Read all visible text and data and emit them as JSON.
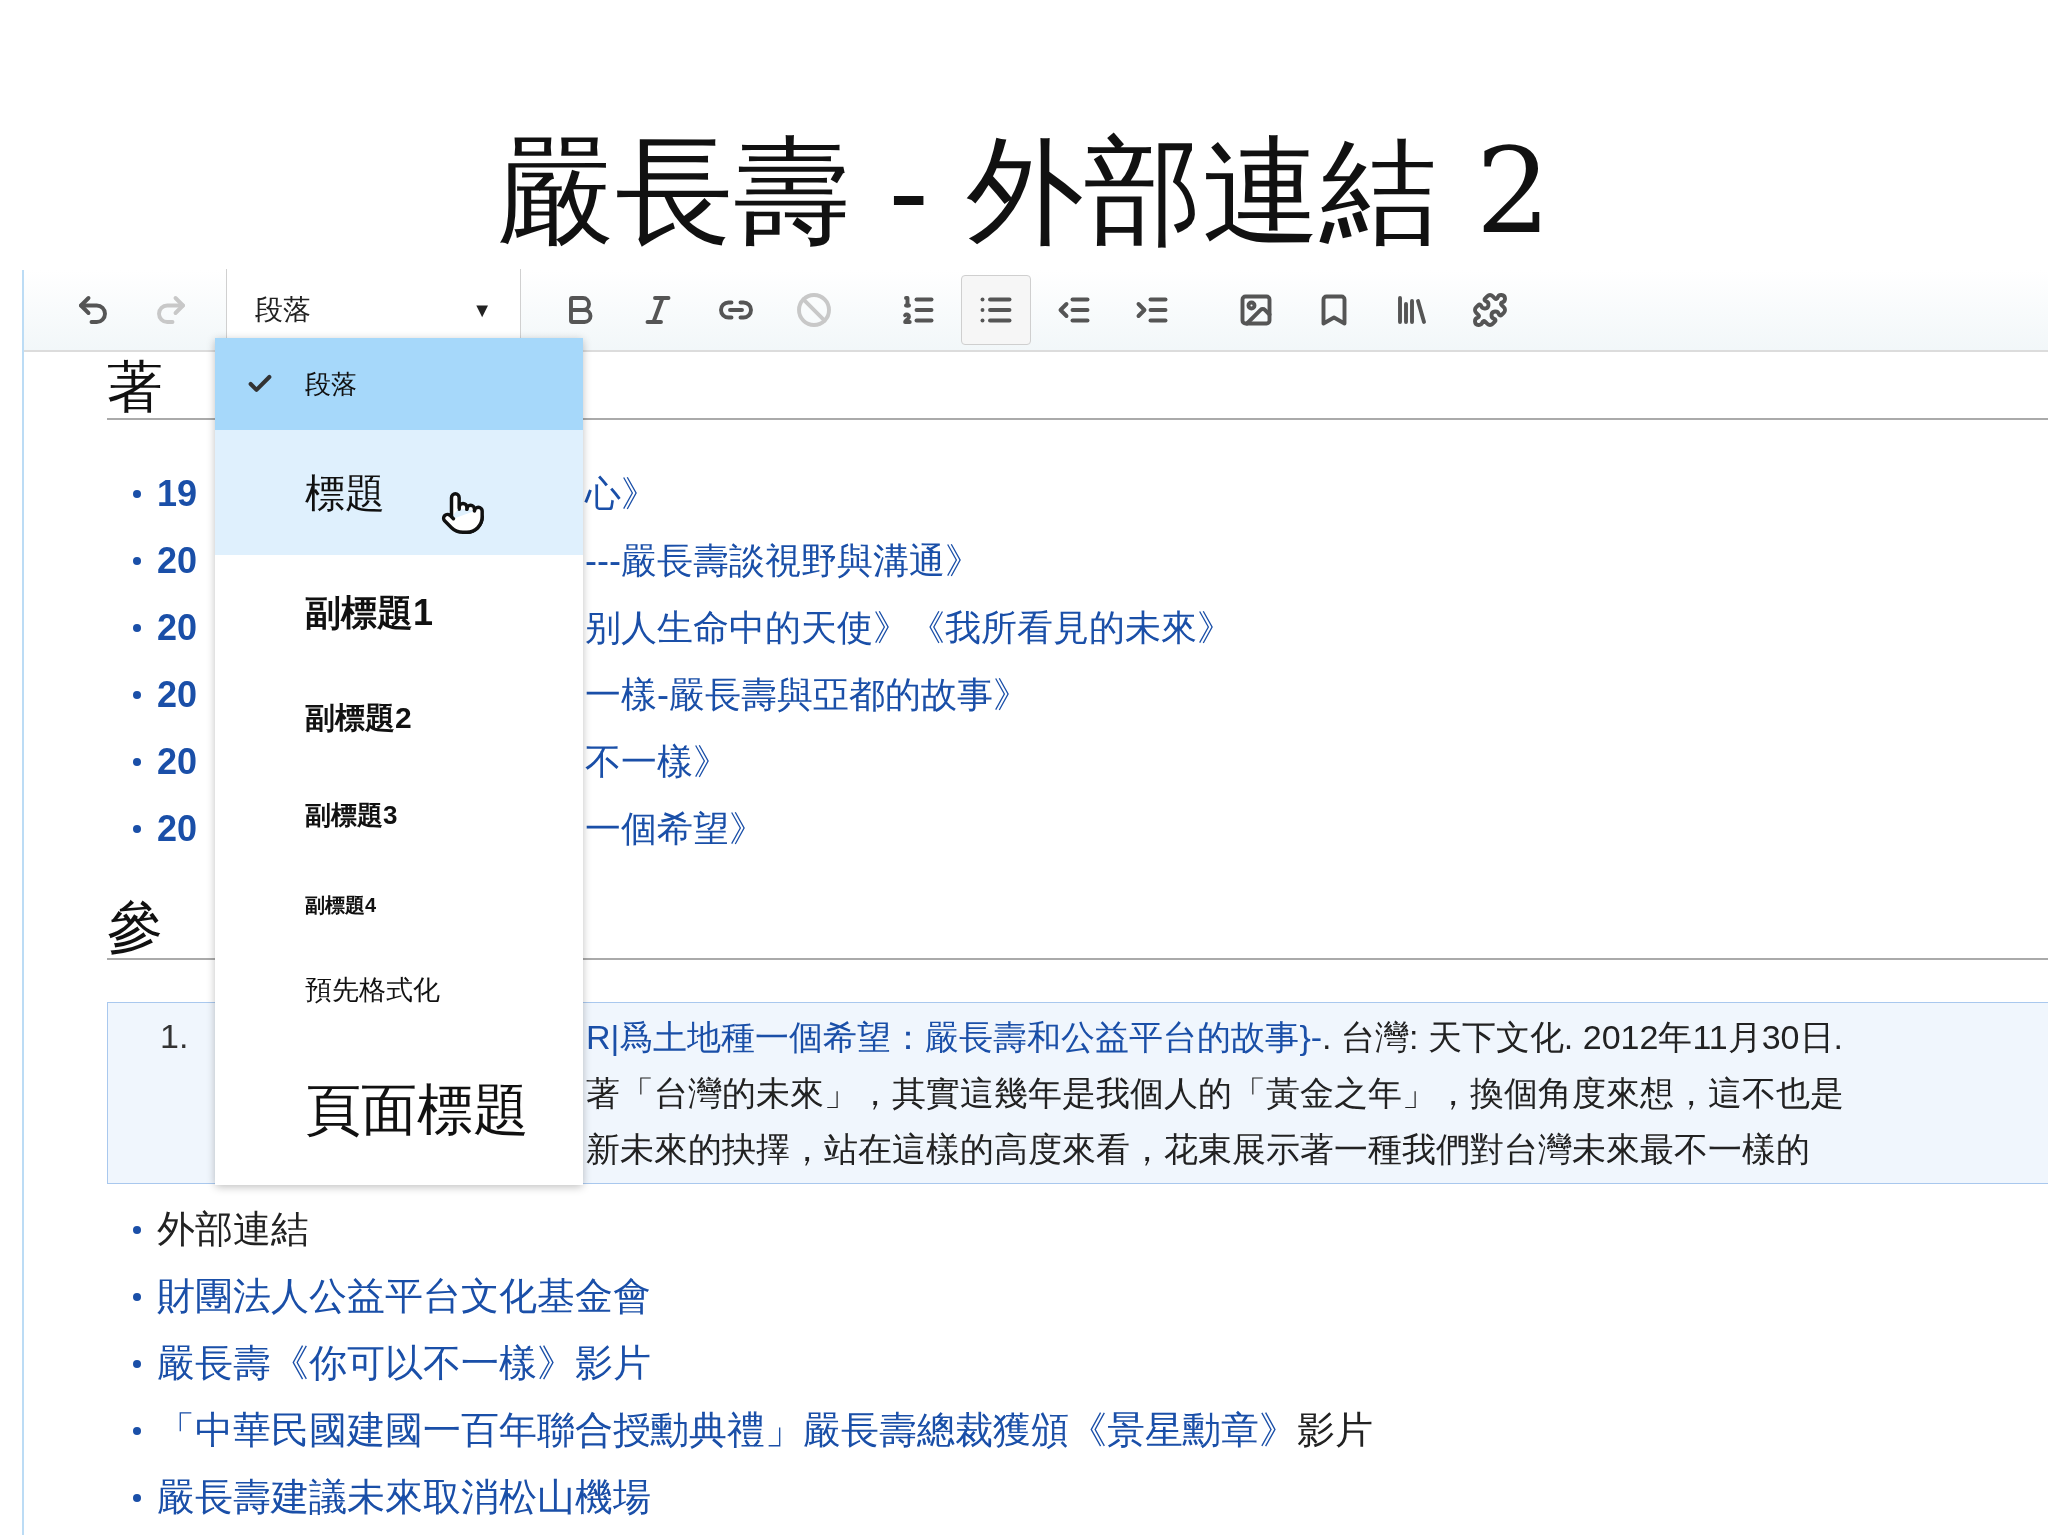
{
  "slide_title": "嚴長壽 - 外部連結 2",
  "toolbar": {
    "buttons": [
      {
        "kind": "undo",
        "disabled": false,
        "active": false
      },
      {
        "kind": "redo",
        "disabled": true,
        "active": false
      },
      {
        "kind": "format",
        "disabled": false,
        "active": false
      },
      {
        "kind": "bold",
        "disabled": false,
        "active": false
      },
      {
        "kind": "italic",
        "disabled": false,
        "active": false
      },
      {
        "kind": "link",
        "disabled": false,
        "active": false
      },
      {
        "kind": "clear",
        "disabled": true,
        "active": false
      },
      {
        "kind": "numbered_list",
        "disabled": false,
        "active": false
      },
      {
        "kind": "bullet_list",
        "disabled": false,
        "active": true
      },
      {
        "kind": "outdent",
        "disabled": false,
        "active": false
      },
      {
        "kind": "indent",
        "disabled": false,
        "active": false
      },
      {
        "kind": "image",
        "disabled": false,
        "active": false
      },
      {
        "kind": "bookmark",
        "disabled": false,
        "active": false
      },
      {
        "kind": "books",
        "disabled": false,
        "active": false
      },
      {
        "kind": "puzzle",
        "disabled": false,
        "active": false
      }
    ],
    "format_dropdown": {
      "value": "段落",
      "caret": "▼"
    }
  },
  "format_menu": {
    "items": [
      {
        "label": "段落",
        "kind": "paragraph",
        "selected": true,
        "hovered": false
      },
      {
        "label": "標題",
        "kind": "heading",
        "selected": false,
        "hovered": true
      },
      {
        "label": "副標題1",
        "kind": "sub1",
        "selected": false,
        "hovered": false
      },
      {
        "label": "副標題2",
        "kind": "sub2",
        "selected": false,
        "hovered": false
      },
      {
        "label": "副標題3",
        "kind": "sub3",
        "selected": false,
        "hovered": false
      },
      {
        "label": "副標題4",
        "kind": "sub4",
        "selected": false,
        "hovered": false
      },
      {
        "label": "預先格式化",
        "kind": "pre",
        "selected": false,
        "hovered": false
      },
      {
        "label": "頁面標題",
        "kind": "page_title",
        "selected": false,
        "hovered": false
      }
    ]
  },
  "heading_1": "著",
  "works_list": [
    {
      "text_start": "19",
      "text_end": "心》"
    },
    {
      "text_start": "20",
      "text_end": "---嚴長壽談視野與溝通》"
    },
    {
      "text_start": "20",
      "text_end": "别人生命中的天使》《我所看見的未來》"
    },
    {
      "text_start": "20",
      "text_end": "一樣-嚴長壽與亞都的故事》"
    },
    {
      "text_start": "20",
      "text_end": "不一樣》"
    },
    {
      "text_start": "20",
      "text_end": "一個希望》"
    }
  ],
  "heading_2": "參",
  "references": [
    {
      "number": "1.",
      "lines": [
        [
          {
            "text": "R|爲土地種一個希望：嚴長壽和公益平台的故事}-",
            "link": true
          },
          {
            "text": ". 台灣: 天下文化. 2012年11月30日.",
            "link": false
          }
        ],
        [
          {
            "text": "著「台灣的未來」，其實這幾年是我個人的「黃金之年」，換個角度來想，這不也是",
            "link": false
          }
        ],
        [
          {
            "text": "新未來的抉擇，站在這樣的高度來看，花東展示著一種我們對台灣未來最不一樣的",
            "link": false
          }
        ]
      ]
    }
  ],
  "external_links": [
    [
      {
        "text": "外部連結",
        "link": false
      }
    ],
    [
      {
        "text": "財團法人公益平台文化基金會",
        "link": true
      }
    ],
    [
      {
        "text": "嚴長壽《你可以不一樣》影片",
        "link": true
      }
    ],
    [
      {
        "text": "「中華民國建國一百年聯合授勳典禮」嚴長壽總裁獲頒《景星勳章》",
        "link": true
      },
      {
        "text": "影片",
        "link": false
      }
    ],
    [
      {
        "text": "嚴長壽建議未來取消松山機場",
        "link": true
      }
    ]
  ]
}
